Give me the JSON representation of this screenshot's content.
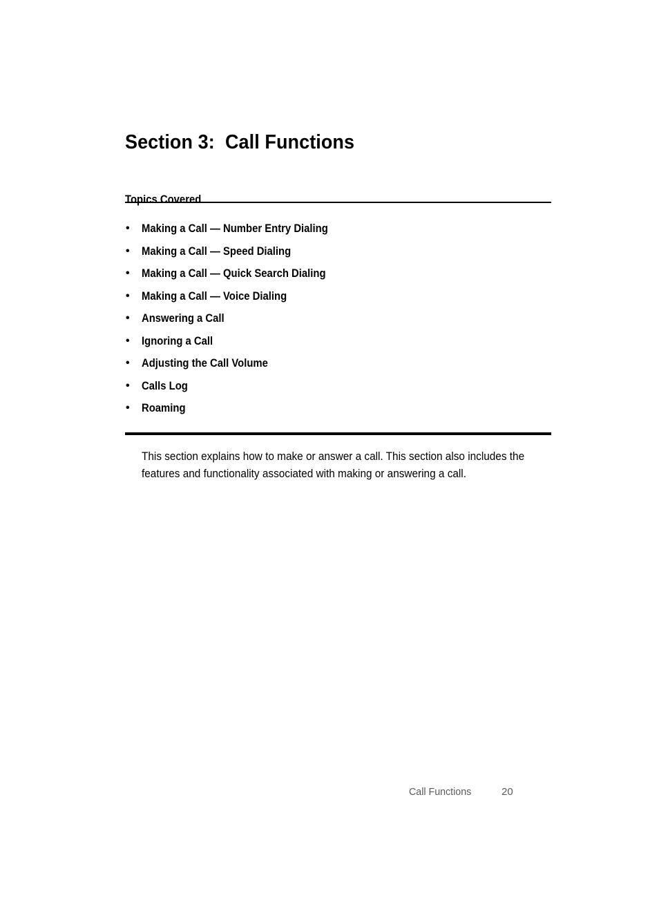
{
  "document": {
    "section_title": "Section 3:  Call Functions",
    "topics_heading": "Topics Covered",
    "topics": [
      {
        "label": "Making a Call — Number Entry Dialing",
        "bullet": "•"
      },
      {
        "label": "Making a Call — Speed Dialing",
        "bullet": "•"
      },
      {
        "label": "Making a Call — Quick Search Dialing",
        "bullet": "•"
      },
      {
        "label": "Making a Call — Voice Dialing",
        "bullet": "•"
      },
      {
        "label": "Answering a Call",
        "bullet": "•"
      },
      {
        "label": "Ignoring a Call",
        "bullet": "•"
      },
      {
        "label": "Adjusting the Call Volume",
        "bullet": "•"
      },
      {
        "label": "Calls Log",
        "bullet": "•"
      },
      {
        "label": "Roaming",
        "bullet": "•"
      }
    ],
    "intro_paragraph": "This section explains how to make or answer a call. This section also includes the features and functionality associated with making or answering a call.",
    "footer": {
      "section_name": "Call Functions",
      "page_number": "20"
    },
    "colors": {
      "text": "#000000",
      "footer_text": "#5a5a5a",
      "rule": "#000000",
      "background": "#ffffff"
    }
  }
}
